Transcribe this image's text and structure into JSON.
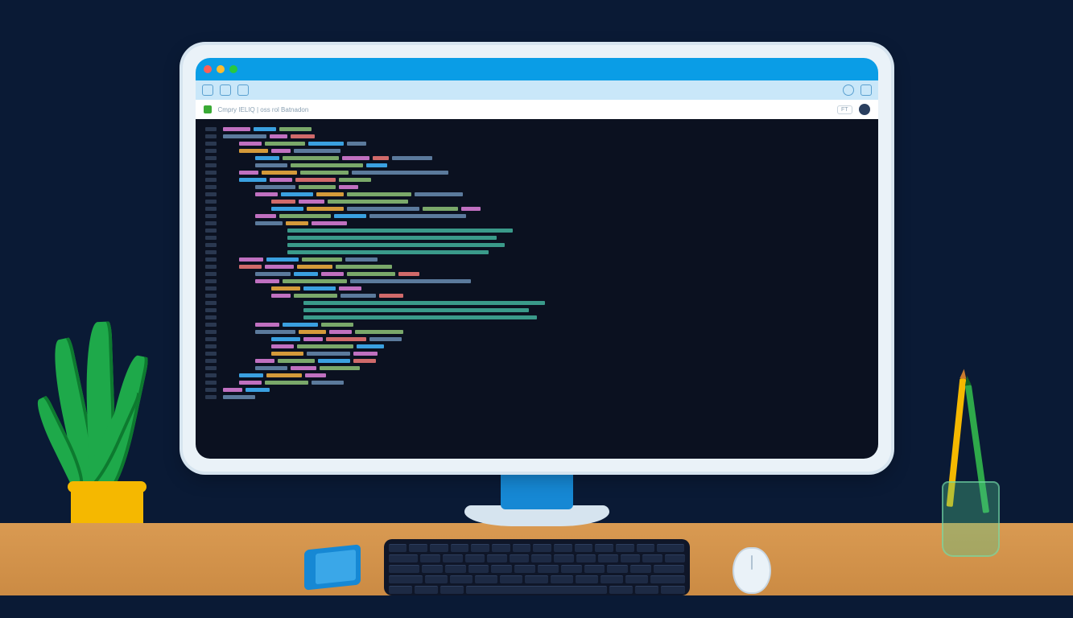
{
  "illustration": {
    "description": "Flat illustration of a desktop computer on a wooden desk showing a code editor in a browser window, with a potted plant, notebook, keyboard, mouse, and pencil cup.",
    "browser": {
      "tab_title": "Cmpry IELIQ | oss rol Batnadon",
      "right_badge": "FT"
    },
    "colors": {
      "background": "#0a1a35",
      "desk": "#d99a52",
      "monitor_bezel": "#eaf2f8",
      "titlebar": "#0a9de6",
      "code_bg": "#0b1120",
      "plant_pot": "#f5b800",
      "leaf": "#1ea94a",
      "notebook": "#1688d4",
      "cup": "#50c88c"
    },
    "desk_items": [
      "plant",
      "notebook",
      "keyboard",
      "mouse",
      "pencil-cup"
    ],
    "code_lines": [
      {
        "indent": 0,
        "segs": [
          [
            "#c070c0",
            34
          ],
          [
            "#3aa0e0",
            28
          ],
          [
            "#7aa86a",
            40
          ]
        ]
      },
      {
        "indent": 0,
        "segs": [
          [
            "#5b7a9c",
            54
          ],
          [
            "#c070c0",
            22
          ],
          [
            "#d06a6a",
            30
          ]
        ]
      },
      {
        "indent": 2,
        "segs": [
          [
            "#c070c0",
            28
          ],
          [
            "#7aa86a",
            50
          ],
          [
            "#3aa0e0",
            44
          ],
          [
            "#5b7a9c",
            24
          ]
        ]
      },
      {
        "indent": 2,
        "segs": [
          [
            "#d49a3a",
            36
          ],
          [
            "#c070c0",
            24
          ],
          [
            "#5b7a9c",
            58
          ]
        ]
      },
      {
        "indent": 4,
        "segs": [
          [
            "#3aa0e0",
            30
          ],
          [
            "#7aa86a",
            70
          ],
          [
            "#c070c0",
            34
          ],
          [
            "#d06a6a",
            20
          ],
          [
            "#5b7a9c",
            50
          ]
        ]
      },
      {
        "indent": 4,
        "segs": [
          [
            "#5b7a9c",
            40
          ],
          [
            "#7aa86a",
            90
          ],
          [
            "#3aa0e0",
            26
          ]
        ]
      },
      {
        "indent": 2,
        "segs": [
          [
            "#c070c0",
            24
          ],
          [
            "#d49a3a",
            44
          ],
          [
            "#7aa86a",
            60
          ],
          [
            "#5b7a9c",
            120
          ]
        ]
      },
      {
        "indent": 2,
        "segs": [
          [
            "#3aa0e0",
            34
          ],
          [
            "#c070c0",
            28
          ],
          [
            "#d06a6a",
            50
          ],
          [
            "#7aa86a",
            40
          ]
        ]
      },
      {
        "indent": 4,
        "segs": [
          [
            "#5b7a9c",
            50
          ],
          [
            "#7aa86a",
            46
          ],
          [
            "#c070c0",
            24
          ]
        ]
      },
      {
        "indent": 4,
        "segs": [
          [
            "#c070c0",
            28
          ],
          [
            "#3aa0e0",
            40
          ],
          [
            "#d49a3a",
            34
          ],
          [
            "#7aa86a",
            80
          ],
          [
            "#5b7a9c",
            60
          ]
        ]
      },
      {
        "indent": 6,
        "segs": [
          [
            "#d06a6a",
            30
          ],
          [
            "#c070c0",
            32
          ],
          [
            "#7aa86a",
            100
          ]
        ]
      },
      {
        "indent": 6,
        "segs": [
          [
            "#3aa0e0",
            40
          ],
          [
            "#d49a3a",
            46
          ],
          [
            "#5b7a9c",
            90
          ],
          [
            "#7aa86a",
            44
          ],
          [
            "#c070c0",
            24
          ]
        ]
      },
      {
        "indent": 4,
        "segs": [
          [
            "#c070c0",
            26
          ],
          [
            "#7aa86a",
            64
          ],
          [
            "#3aa0e0",
            40
          ],
          [
            "#5b7a9c",
            120
          ]
        ]
      },
      {
        "indent": 4,
        "segs": [
          [
            "#5b7a9c",
            34
          ],
          [
            "#d49a3a",
            28
          ],
          [
            "#c070c0",
            44
          ]
        ]
      },
      {
        "indent": 8,
        "segs": [
          [
            "#3a9a8a",
            280
          ]
        ]
      },
      {
        "indent": 8,
        "segs": [
          [
            "#3a9a8a",
            260
          ]
        ]
      },
      {
        "indent": 8,
        "segs": [
          [
            "#3a9a8a",
            270
          ]
        ]
      },
      {
        "indent": 8,
        "segs": [
          [
            "#3a9a8a",
            250
          ]
        ]
      },
      {
        "indent": 2,
        "segs": [
          [
            "#c070c0",
            30
          ],
          [
            "#3aa0e0",
            40
          ],
          [
            "#7aa86a",
            50
          ],
          [
            "#5b7a9c",
            40
          ]
        ]
      },
      {
        "indent": 2,
        "segs": [
          [
            "#d06a6a",
            28
          ],
          [
            "#c070c0",
            36
          ],
          [
            "#d49a3a",
            44
          ],
          [
            "#7aa86a",
            70
          ]
        ]
      },
      {
        "indent": 4,
        "segs": [
          [
            "#5b7a9c",
            44
          ],
          [
            "#3aa0e0",
            30
          ],
          [
            "#c070c0",
            28
          ],
          [
            "#7aa86a",
            60
          ],
          [
            "#d06a6a",
            26
          ]
        ]
      },
      {
        "indent": 4,
        "segs": [
          [
            "#c070c0",
            30
          ],
          [
            "#7aa86a",
            80
          ],
          [
            "#5b7a9c",
            150
          ]
        ]
      },
      {
        "indent": 6,
        "segs": [
          [
            "#d49a3a",
            36
          ],
          [
            "#3aa0e0",
            40
          ],
          [
            "#c070c0",
            28
          ]
        ]
      },
      {
        "indent": 6,
        "segs": [
          [
            "#c070c0",
            24
          ],
          [
            "#7aa86a",
            54
          ],
          [
            "#5b7a9c",
            44
          ],
          [
            "#d06a6a",
            30
          ]
        ]
      },
      {
        "indent": 10,
        "segs": [
          [
            "#3a9a8a",
            300
          ]
        ]
      },
      {
        "indent": 10,
        "segs": [
          [
            "#3a9a8a",
            280
          ]
        ]
      },
      {
        "indent": 10,
        "segs": [
          [
            "#3a9a8a",
            290
          ]
        ]
      },
      {
        "indent": 4,
        "segs": [
          [
            "#c070c0",
            30
          ],
          [
            "#3aa0e0",
            44
          ],
          [
            "#7aa86a",
            40
          ]
        ]
      },
      {
        "indent": 4,
        "segs": [
          [
            "#5b7a9c",
            50
          ],
          [
            "#d49a3a",
            34
          ],
          [
            "#c070c0",
            28
          ],
          [
            "#7aa86a",
            60
          ]
        ]
      },
      {
        "indent": 6,
        "segs": [
          [
            "#3aa0e0",
            36
          ],
          [
            "#c070c0",
            24
          ],
          [
            "#d06a6a",
            50
          ],
          [
            "#5b7a9c",
            40
          ]
        ]
      },
      {
        "indent": 6,
        "segs": [
          [
            "#c070c0",
            28
          ],
          [
            "#7aa86a",
            70
          ],
          [
            "#3aa0e0",
            34
          ]
        ]
      },
      {
        "indent": 6,
        "segs": [
          [
            "#d49a3a",
            40
          ],
          [
            "#5b7a9c",
            54
          ],
          [
            "#c070c0",
            30
          ]
        ]
      },
      {
        "indent": 4,
        "segs": [
          [
            "#c070c0",
            24
          ],
          [
            "#7aa86a",
            46
          ],
          [
            "#3aa0e0",
            40
          ],
          [
            "#d06a6a",
            28
          ]
        ]
      },
      {
        "indent": 4,
        "segs": [
          [
            "#5b7a9c",
            40
          ],
          [
            "#c070c0",
            32
          ],
          [
            "#7aa86a",
            50
          ]
        ]
      },
      {
        "indent": 2,
        "segs": [
          [
            "#3aa0e0",
            30
          ],
          [
            "#d49a3a",
            44
          ],
          [
            "#c070c0",
            26
          ]
        ]
      },
      {
        "indent": 2,
        "segs": [
          [
            "#c070c0",
            28
          ],
          [
            "#7aa86a",
            54
          ],
          [
            "#5b7a9c",
            40
          ]
        ]
      },
      {
        "indent": 0,
        "segs": [
          [
            "#c070c0",
            24
          ],
          [
            "#3aa0e0",
            30
          ]
        ]
      },
      {
        "indent": 0,
        "segs": [
          [
            "#5b7a9c",
            40
          ]
        ]
      }
    ]
  }
}
